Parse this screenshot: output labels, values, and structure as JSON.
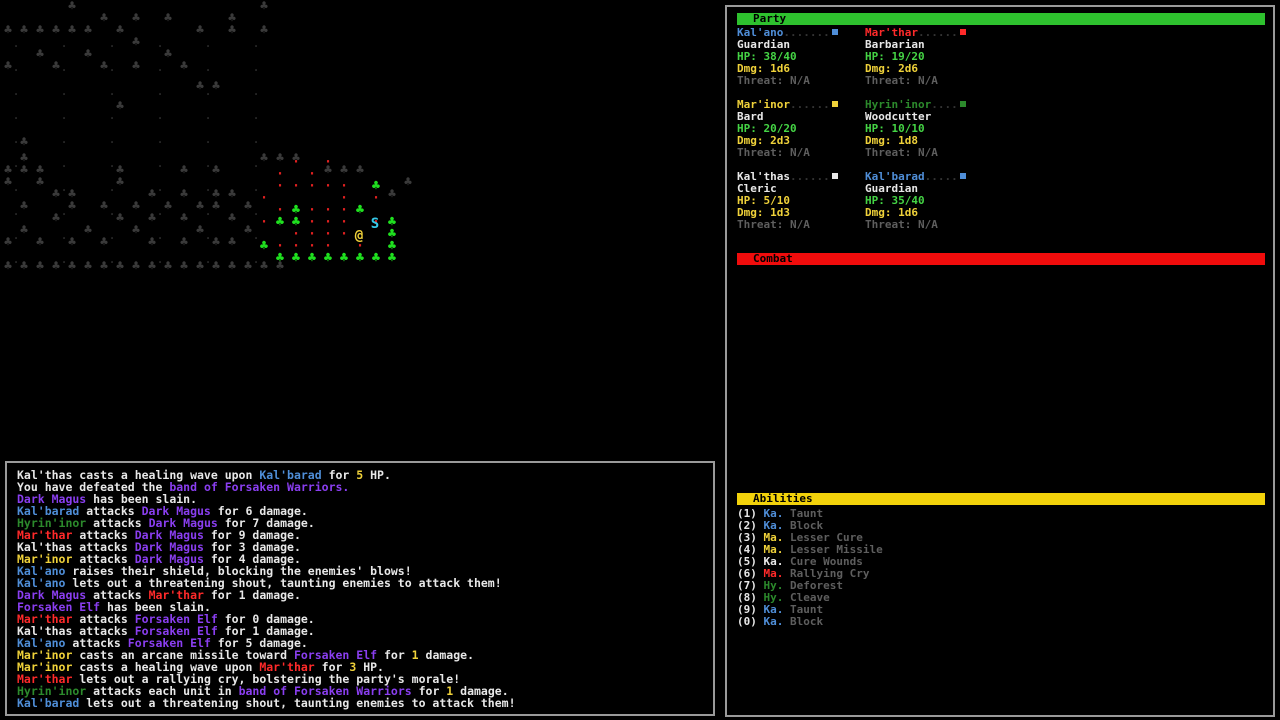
{
  "colors": {
    "blue": "#4f8ed8",
    "red": "#ff2a2a",
    "yellow": "#f0d23a",
    "darkgreen": "#2c8a2c",
    "purple": "#8a3ef0",
    "white": "#e8e8e8",
    "gray": "#5e5e5e",
    "green": "#45d545",
    "partybar": "#2ec12e",
    "combatbar": "#f00c0c",
    "abilitiesbar": "#f2d20b"
  },
  "map": {
    "player_glyph": "@",
    "ally_glyph": "S",
    "tree_glyph": "♣",
    "floor_glyph": "·"
  },
  "sidebar": {
    "party_label": "Party",
    "combat_label": "Combat",
    "abilities_label": "Abilities",
    "members": [
      {
        "name": "Kal'ano",
        "name_color": "blue",
        "badge_color": "#4f8ed8",
        "cls": "Guardian",
        "hp": "HP: 38/40",
        "hp_color": "green",
        "dmg": "Dmg: 1d6",
        "threat": "Threat: N/A"
      },
      {
        "name": "Mar'thar",
        "name_color": "red",
        "badge_color": "#ff2a2a",
        "cls": "Barbarian",
        "hp": "HP: 19/20",
        "hp_color": "green",
        "dmg": "Dmg: 2d6",
        "threat": "Threat: N/A"
      },
      {
        "name": "Mar'inor",
        "name_color": "yellow",
        "badge_color": "#f0d23a",
        "cls": "Bard",
        "hp": "HP: 20/20",
        "hp_color": "green",
        "dmg": "Dmg: 2d3",
        "threat": "Threat: N/A"
      },
      {
        "name": "Hyrin'inor",
        "name_color": "darkgreen",
        "badge_color": "#2c8a2c",
        "cls": "Woodcutter",
        "hp": "HP: 10/10",
        "hp_color": "green",
        "dmg": "Dmg: 1d8",
        "threat": "Threat: N/A"
      },
      {
        "name": "Kal'thas",
        "name_color": "white",
        "badge_color": "#e8e8e8",
        "cls": "Cleric",
        "hp": "HP: 5/10",
        "hp_color": "yellow",
        "dmg": "Dmg: 1d3",
        "threat": "Threat: N/A"
      },
      {
        "name": "Kal'barad",
        "name_color": "blue",
        "badge_color": "#4f8ed8",
        "cls": "Guardian",
        "hp": "HP: 35/40",
        "hp_color": "green",
        "dmg": "Dmg: 1d6",
        "threat": "Threat: N/A"
      }
    ],
    "abilities": [
      {
        "key": "(1)",
        "who": "Ka.",
        "who_color": "blue",
        "name": "Taunt"
      },
      {
        "key": "(2)",
        "who": "Ka.",
        "who_color": "blue",
        "name": "Block"
      },
      {
        "key": "(3)",
        "who": "Ma.",
        "who_color": "yellow",
        "name": "Lesser Cure"
      },
      {
        "key": "(4)",
        "who": "Ma.",
        "who_color": "yellow",
        "name": "Lesser Missile"
      },
      {
        "key": "(5)",
        "who": "Ka.",
        "who_color": "white",
        "name": "Cure Wounds"
      },
      {
        "key": "(6)",
        "who": "Ma.",
        "who_color": "red",
        "name": "Rallying Cry"
      },
      {
        "key": "(7)",
        "who": "Hy.",
        "who_color": "darkgreen",
        "name": "Deforest"
      },
      {
        "key": "(8)",
        "who": "Hy.",
        "who_color": "darkgreen",
        "name": "Cleave"
      },
      {
        "key": "(9)",
        "who": "Ka.",
        "who_color": "blue",
        "name": "Taunt"
      },
      {
        "key": "(0)",
        "who": "Ka.",
        "who_color": "blue",
        "name": "Block"
      }
    ]
  },
  "log": [
    [
      [
        "Kal'thas casts a healing wave upon ",
        "white"
      ],
      [
        "Kal'barad",
        "blue"
      ],
      [
        " for ",
        "white"
      ],
      [
        "5",
        "yellow"
      ],
      [
        " HP.",
        "white"
      ]
    ],
    [
      [
        "You have defeated the ",
        "white"
      ],
      [
        "band of Forsaken Warriors.",
        "purple"
      ]
    ],
    [
      [
        "Dark Magus",
        "purple"
      ],
      [
        " has been slain.",
        "white"
      ]
    ],
    [
      [
        "Kal'barad",
        "blue"
      ],
      [
        " attacks ",
        "white"
      ],
      [
        "Dark Magus",
        "purple"
      ],
      [
        " for 6 damage.",
        "white"
      ]
    ],
    [
      [
        "Hyrin'inor",
        "darkgreen"
      ],
      [
        " attacks ",
        "white"
      ],
      [
        "Dark Magus",
        "purple"
      ],
      [
        " for 7 damage.",
        "white"
      ]
    ],
    [
      [
        "Mar'thar",
        "red"
      ],
      [
        " attacks ",
        "white"
      ],
      [
        "Dark Magus",
        "purple"
      ],
      [
        " for 9 damage.",
        "white"
      ]
    ],
    [
      [
        "Kal'thas attacks ",
        "white"
      ],
      [
        "Dark Magus",
        "purple"
      ],
      [
        " for 3 damage.",
        "white"
      ]
    ],
    [
      [
        "Mar'inor",
        "yellow"
      ],
      [
        " attacks ",
        "white"
      ],
      [
        "Dark Magus",
        "purple"
      ],
      [
        " for 4 damage.",
        "white"
      ]
    ],
    [
      [
        "Kal'ano",
        "blue"
      ],
      [
        " raises their shield, blocking the enemies' blows!",
        "white"
      ]
    ],
    [
      [
        "Kal'ano",
        "blue"
      ],
      [
        " lets out a threatening shout, taunting enemies to attack them!",
        "white"
      ]
    ],
    [
      [
        "Dark Magus",
        "purple"
      ],
      [
        " attacks ",
        "white"
      ],
      [
        "Mar'thar",
        "red"
      ],
      [
        " for 1 damage.",
        "white"
      ]
    ],
    [
      [
        "Forsaken Elf",
        "purple"
      ],
      [
        " has been slain.",
        "white"
      ]
    ],
    [
      [
        "Mar'thar",
        "red"
      ],
      [
        " attacks ",
        "white"
      ],
      [
        "Forsaken Elf",
        "purple"
      ],
      [
        " for 0 damage.",
        "white"
      ]
    ],
    [
      [
        "Kal'thas attacks ",
        "white"
      ],
      [
        "Forsaken Elf",
        "purple"
      ],
      [
        " for 1 damage.",
        "white"
      ]
    ],
    [
      [
        "Kal'ano",
        "blue"
      ],
      [
        " attacks ",
        "white"
      ],
      [
        "Forsaken Elf",
        "purple"
      ],
      [
        " for 5 damage.",
        "white"
      ]
    ],
    [
      [
        "Mar'inor",
        "yellow"
      ],
      [
        " casts an arcane missile toward ",
        "white"
      ],
      [
        "Forsaken Elf",
        "purple"
      ],
      [
        " for ",
        "white"
      ],
      [
        "1",
        "yellow"
      ],
      [
        " damage.",
        "white"
      ]
    ],
    [
      [
        "Mar'inor",
        "yellow"
      ],
      [
        " casts a healing wave upon ",
        "white"
      ],
      [
        "Mar'thar",
        "red"
      ],
      [
        " for ",
        "white"
      ],
      [
        "3",
        "yellow"
      ],
      [
        " HP.",
        "white"
      ]
    ],
    [
      [
        "Mar'thar",
        "red"
      ],
      [
        " lets out a rallying cry, bolstering the party's morale!",
        "white"
      ]
    ],
    [
      [
        "Hyrin'inor",
        "darkgreen"
      ],
      [
        " attacks each unit in ",
        "white"
      ],
      [
        "band of Forsaken Warriors",
        "purple"
      ],
      [
        " for ",
        "white"
      ],
      [
        "1",
        "yellow"
      ],
      [
        " damage.",
        "white"
      ]
    ],
    [
      [
        "Kal'barad",
        "blue"
      ],
      [
        " lets out a threatening shout, taunting enemies to attack them!",
        "white"
      ]
    ]
  ]
}
